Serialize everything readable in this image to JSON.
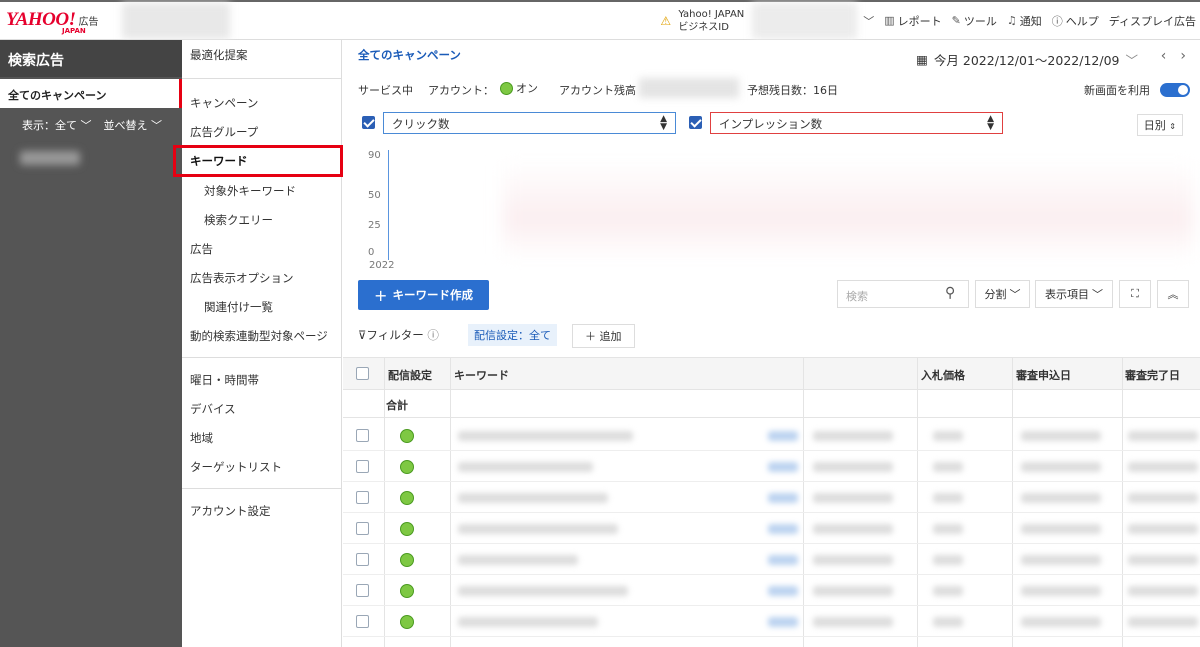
{
  "header": {
    "logo_text": "YAHOO!",
    "logo_sub": "JAPAN",
    "logo_suffix": "広告",
    "business_id_line1": "Yahoo! JAPAN",
    "business_id_line2": "ビジネスID",
    "menu": {
      "report": "レポート",
      "tools": "ツール",
      "notifications": "通知",
      "help": "ヘルプ",
      "display_ads": "ディスプレイ広告"
    }
  },
  "sidebar": {
    "title": "検索広告",
    "all_campaigns": "全てのキャンペーン",
    "display_label": "表示：全て",
    "sort_label": "並べ替え"
  },
  "nav": {
    "items": [
      {
        "label": "最適化提案"
      },
      {
        "label": "キャンペーン"
      },
      {
        "label": "広告グループ"
      },
      {
        "label": "キーワード"
      },
      {
        "label": "対象外キーワード"
      },
      {
        "label": "検索クエリー"
      },
      {
        "label": "広告"
      },
      {
        "label": "広告表示オプション"
      },
      {
        "label": "関連付け一覧"
      },
      {
        "label": "動的検索連動型対象ページ"
      },
      {
        "label": "曜日・時間帯"
      },
      {
        "label": "デバイス"
      },
      {
        "label": "地域"
      },
      {
        "label": "ターゲットリスト"
      },
      {
        "label": "アカウント設定"
      }
    ]
  },
  "main": {
    "breadcrumb": "全てのキャンペーン",
    "date_range": "今月 2022/12/01〜2022/12/09",
    "status_service": "サービス中",
    "status_account_label": "アカウント：",
    "status_account_value": "オン",
    "status_balance_label": "アカウント残高",
    "status_days": "予想残日数：16日",
    "new_screen_label": "新画面を利用",
    "new_screen_on": true,
    "metric1": "クリック数",
    "metric2": "インプレッション数",
    "granularity": "日別",
    "y_ticks": [
      "90",
      "50",
      "25",
      "0"
    ],
    "x_tick": "2022",
    "create_keyword": "キーワード作成",
    "search_placeholder": "検索",
    "split_label": "分割",
    "display_items_label": "表示項目",
    "filter_label": "フィルター",
    "filter_chip": "配信設定：全て",
    "add_label": "追加"
  },
  "table": {
    "headers": {
      "delivery": "配信設定",
      "keyword": "キーワード",
      "bid": "入札価格",
      "review_applied": "審査申込日",
      "review_done": "審査完了日"
    },
    "total_label": "合計",
    "row_count": 7
  },
  "colors": {
    "brand_red": "#e60012",
    "accent_blue": "#2b6fcf",
    "status_green": "#7ec843"
  }
}
